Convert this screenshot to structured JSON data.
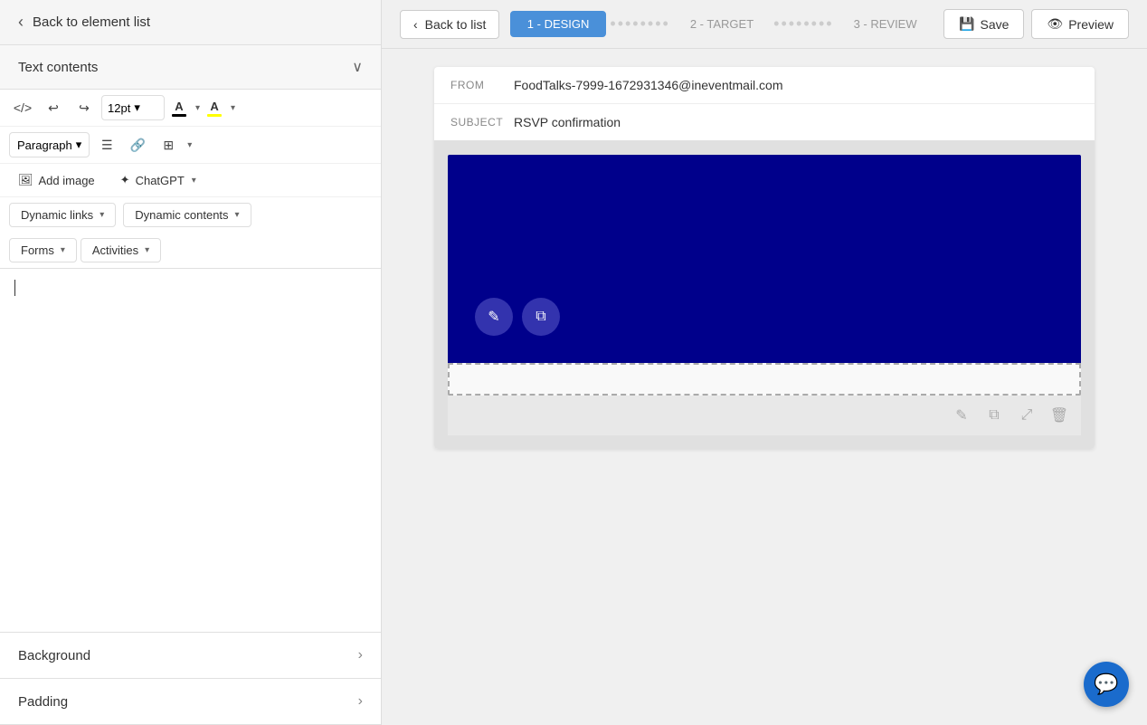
{
  "left_panel": {
    "back_button_label": "Back to element list",
    "text_contents_label": "Text contents",
    "toolbar": {
      "font_size": "12pt",
      "font_size_placeholder": "12pt",
      "paragraph_label": "Paragraph"
    },
    "add_image_label": "Add image",
    "chatgpt_label": "ChatGPT",
    "dynamic_links_label": "Dynamic links",
    "dynamic_contents_label": "Dynamic contents",
    "forms_label": "Forms",
    "activities_label": "Activities",
    "background_label": "Background",
    "padding_label": "Padding"
  },
  "top_bar": {
    "back_to_list_label": "Back to list",
    "step1_label": "1 - DESIGN",
    "step2_label": "2 - TARGET",
    "step3_label": "3 - REVIEW",
    "save_label": "Save",
    "preview_label": "Preview"
  },
  "email": {
    "from_label": "FROM",
    "from_value": "FoodTalks-7999-1672931346@ineventmail.com",
    "subject_label": "SUBJECT",
    "subject_value": "RSVP confirmation"
  },
  "icons": {
    "code": "</>",
    "undo": "↩",
    "redo": "↪",
    "text_color": "A",
    "highlight": "A",
    "bullet_list": "≡",
    "link": "🔗",
    "table": "⊞",
    "chevron_down": "∨",
    "chevron_right": "›",
    "back_chevron": "‹",
    "save_icon": "💾",
    "preview_icon": "👁",
    "chat_icon": "💬",
    "edit_icon": "✎",
    "copy_icon": "⧉",
    "move_icon": "⤢",
    "delete_icon": "🗑",
    "add_image_icon": "🖼",
    "chatgpt_icon": "✦"
  }
}
